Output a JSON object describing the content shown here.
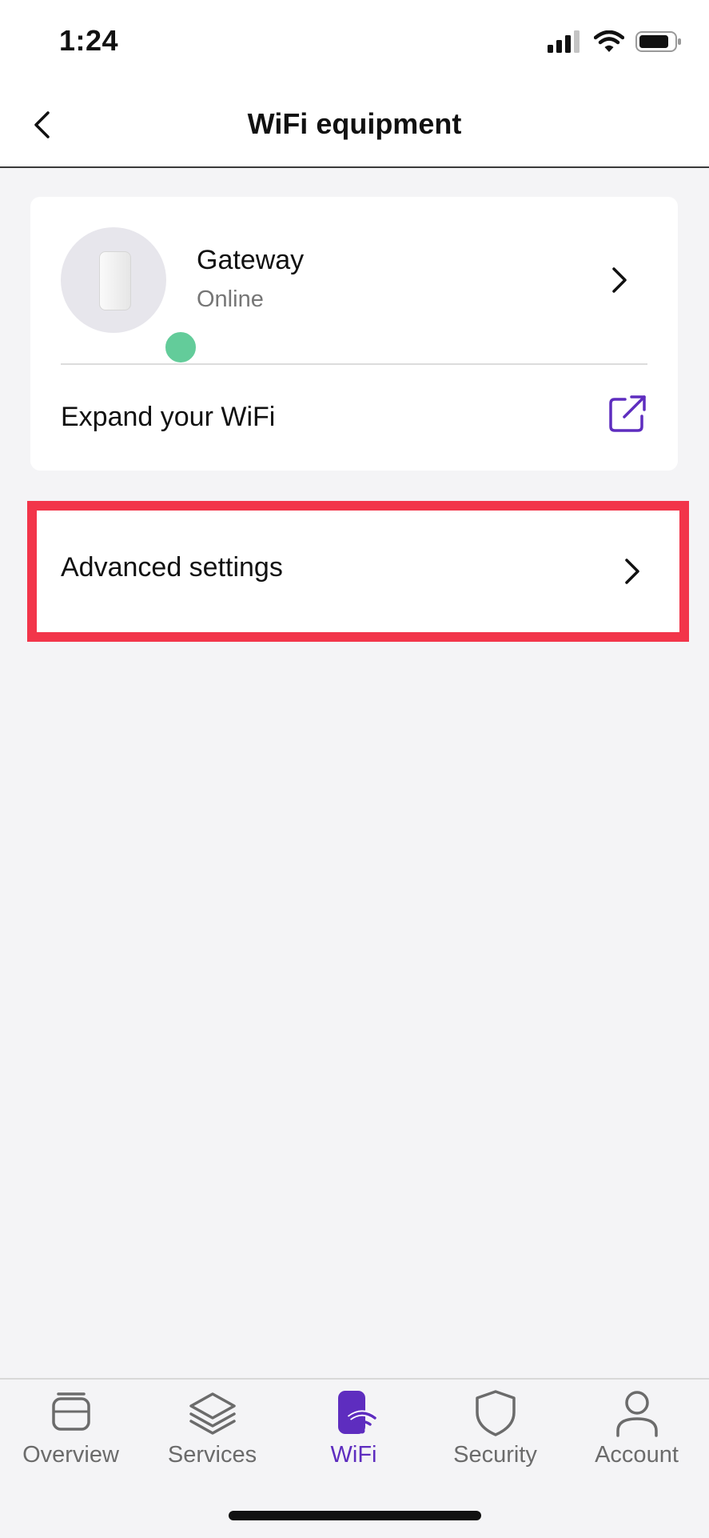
{
  "status_bar": {
    "time": "1:24"
  },
  "header": {
    "title": "WiFi equipment"
  },
  "gateway": {
    "name": "Gateway",
    "status": "Online"
  },
  "expand": {
    "label": "Expand your WiFi"
  },
  "advanced": {
    "label": "Advanced settings"
  },
  "tabs": [
    {
      "label": "Overview",
      "icon": "overview-icon"
    },
    {
      "label": "Services",
      "icon": "layers-icon"
    },
    {
      "label": "WiFi",
      "icon": "wifi-device-icon",
      "active": true
    },
    {
      "label": "Security",
      "icon": "shield-icon"
    },
    {
      "label": "Account",
      "icon": "person-icon"
    }
  ],
  "colors": {
    "accent": "#5e2dbf",
    "online": "#63cc9a",
    "highlight": "#f2354a",
    "background": "#f4f4f6"
  }
}
